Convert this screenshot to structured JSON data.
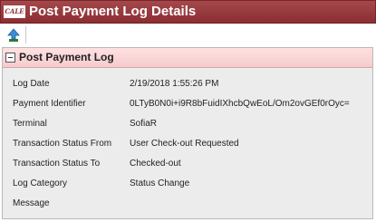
{
  "header": {
    "logo_text": "CALE",
    "title": "Post Payment Log Details"
  },
  "toolbar": {
    "refresh_icon": "up-arrow-icon"
  },
  "panel": {
    "title": "Post Payment Log",
    "fields": [
      {
        "label": "Log Date",
        "value": "2/19/2018 1:55:26 PM"
      },
      {
        "label": "Payment Identifier",
        "value": "0LTyB0N0i+i9R8bFuidIXhcbQwEoL/Om2ovGEf0rOyc="
      },
      {
        "label": "Terminal",
        "value": "SofiaR"
      },
      {
        "label": "Transaction Status From",
        "value": "User Check-out Requested"
      },
      {
        "label": "Transaction Status To",
        "value": "Checked-out"
      },
      {
        "label": "Log Category",
        "value": "Status Change"
      },
      {
        "label": "Message",
        "value": ""
      }
    ]
  },
  "colors": {
    "title_bar": "#8c2e33",
    "panel_header": "#f6cccd"
  }
}
